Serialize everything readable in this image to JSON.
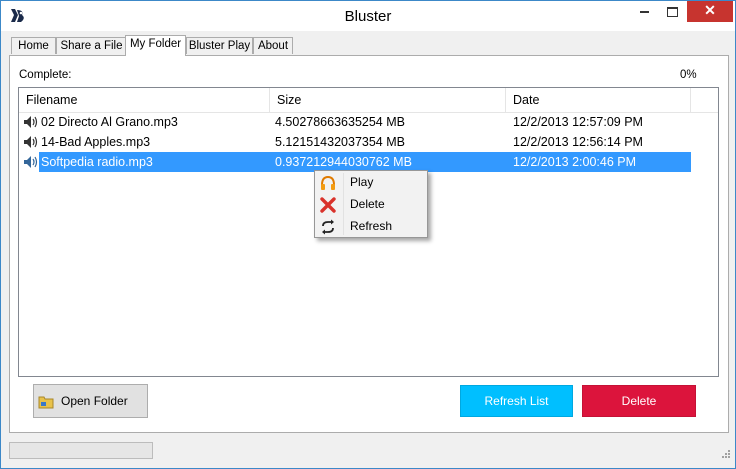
{
  "window": {
    "title": "Bluster",
    "close_glyph": "✕"
  },
  "tabs": [
    {
      "label": "Home"
    },
    {
      "label": "Share a File"
    },
    {
      "label": "My Folder",
      "active": true
    },
    {
      "label": "Bluster Play"
    },
    {
      "label": "About"
    }
  ],
  "status": {
    "complete_label": "Complete:",
    "percent": "0%"
  },
  "list": {
    "columns": [
      "Filename",
      "Size",
      "Date"
    ],
    "rows": [
      {
        "icon": "speaker-icon",
        "filename": "02 Directo Al Grano.mp3",
        "size": "4.50278663635254 MB",
        "date": "12/2/2013 12:57:09 PM",
        "selected": false
      },
      {
        "icon": "speaker-icon",
        "filename": "14-Bad Apples.mp3",
        "size": "5.12151432037354 MB",
        "date": "12/2/2013 12:56:14 PM",
        "selected": false
      },
      {
        "icon": "speaker-icon",
        "filename": "Softpedia radio.mp3",
        "size": "0.937212944030762 MB",
        "date": "12/2/2013 2:00:46 PM",
        "selected": true
      }
    ]
  },
  "context_menu": {
    "items": [
      {
        "label": "Play",
        "icon": "headphones-icon"
      },
      {
        "label": "Delete",
        "icon": "red-x-icon"
      },
      {
        "label": "Refresh",
        "icon": "refresh-icon"
      }
    ]
  },
  "buttons": {
    "open_folder": "Open Folder",
    "refresh_list": "Refresh List",
    "delete": "Delete"
  },
  "colors": {
    "refresh_button": "#00bfff",
    "delete_button": "#dc143c",
    "selection": "#3399ff",
    "close_button": "#c7342f"
  }
}
